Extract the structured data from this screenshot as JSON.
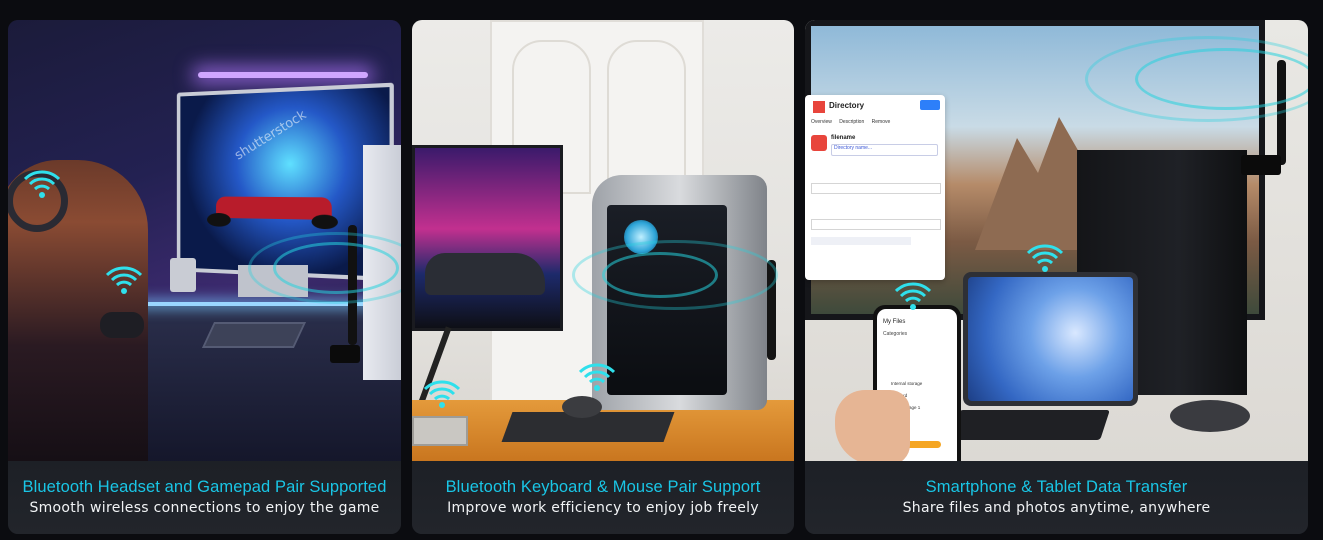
{
  "panels": [
    {
      "title": "Bluetooth Headset and Gamepad Pair Supported",
      "subtitle": "Smooth wireless connections to enjoy the game",
      "watermark": "shutterstock"
    },
    {
      "title": "Bluetooth Keyboard & Mouse Pair Support",
      "subtitle": "Improve work efficiency to enjoy job freely"
    },
    {
      "title": "Smartphone & Tablet Data Transfer",
      "subtitle": "Share files and photos anytime, anywhere",
      "dialog": {
        "app_name": "Directory",
        "filename_label": "filename",
        "filename_placeholder": "Directory name...",
        "tabs": [
          "Overview",
          "Description",
          "Remove"
        ]
      },
      "phone": {
        "header": "My Files",
        "section": "Categories",
        "storage_items": [
          "Internal storage",
          "SD card",
          "USB storage 1"
        ]
      }
    }
  ],
  "colors": {
    "accent_cyan": "#19c6e6",
    "caption_bg": "#1e2127"
  }
}
